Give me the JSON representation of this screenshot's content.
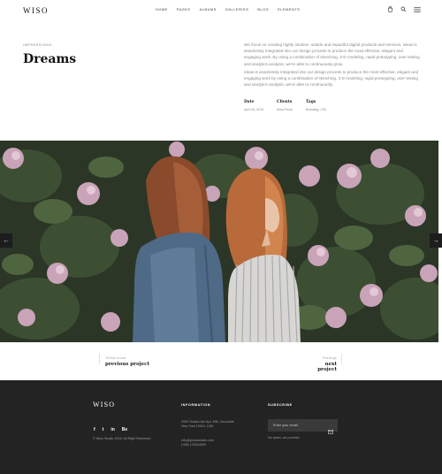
{
  "header": {
    "logo": "WISO",
    "nav": [
      "HOME",
      "PAGES",
      "ALBUMS",
      "GALLERIES",
      "BLOG",
      "ELEMENTS"
    ],
    "icons": [
      "cart-icon",
      "search-icon",
      "menu-icon"
    ]
  },
  "intro": {
    "eyebrow": "IMPRESSIONS",
    "title": "Dreams",
    "paragraph_1": "We focus on creating highly intuitive, usable and impactful digital products and services. Ideas is seamlessly integrated into our design process to produce the most effective, elegant and engaging work. By using a combination of sketching, 3-D modeling, rapid prototyping, user testing and analytics analysis, we're able to continuously grow.",
    "paragraph_2": "Ideas is seamlessly integrated into our design process to produce the most effective, elegant and engaging work by using a combination of sketching, 3-D modeling, rapid prototyping, user testing and analytics analysis, we're able to continuously.",
    "meta": [
      {
        "label": "Date",
        "value": "April 26, 2016"
      },
      {
        "label": "Clients",
        "value": "Mina Fiona"
      },
      {
        "label": "Tags",
        "value": "Branding, CRL"
      }
    ]
  },
  "slider": {
    "prev_arrow": "←",
    "next_arrow": "→"
  },
  "project_nav": {
    "prev_small": "Yellow mood",
    "prev_label": "previous project",
    "next_small": "Feelings",
    "next_label": "next project"
  },
  "footer": {
    "logo": "WISO",
    "socials": [
      "f",
      "t",
      "in",
      "Be"
    ],
    "copyright": "© Wiso Studio 2016. All Right Reserved.",
    "info_heading": "INFORMATION",
    "address_1": "2000 Stokes Isle Apt. 896, Vernaville",
    "address_2": "New York 10010, USA",
    "email": "info@yourdomain.com",
    "phone": "(+68) 120034509",
    "subscribe_heading": "SUBSCRIBE",
    "email_placeholder": "Enter your email",
    "spam_note": "No spam, we promise"
  },
  "colors": {
    "footer_bg": "#232323",
    "accent_dark": "#111111",
    "muted_text": "#8a8a8a"
  }
}
